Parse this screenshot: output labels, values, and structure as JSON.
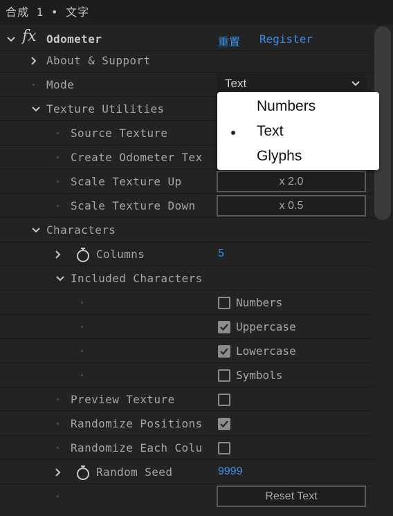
{
  "window": {
    "title": "合成 1 • 文字"
  },
  "effect": {
    "icon": "fx-icon",
    "name": "Odometer",
    "reset_label": "重置",
    "register_label": "Register"
  },
  "rows": {
    "about": "About & Support",
    "mode": "Mode",
    "mode_value": "Text",
    "texture_utilities": "Texture Utilities",
    "source_texture": "Source Texture",
    "create_odometer": "Create Odometer Tex",
    "scale_up": "Scale Texture Up",
    "scale_up_btn": "x 2.0",
    "scale_down": "Scale Texture Down",
    "scale_down_btn": "x 0.5",
    "characters": "Characters",
    "columns": "Columns",
    "columns_value": "5",
    "included_characters": "Included Characters",
    "numbers": "Numbers",
    "uppercase": "Uppercase",
    "lowercase": "Lowercase",
    "symbols": "Symbols",
    "preview_texture": "Preview Texture",
    "randomize_positions": "Randomize Positions",
    "randomize_each": "Randomize Each Colu",
    "random_seed": "Random Seed",
    "random_seed_value": "9999",
    "reset_text_btn": "Reset Text"
  },
  "checkboxes": {
    "numbers": false,
    "uppercase": true,
    "lowercase": true,
    "symbols": false,
    "preview_texture": false,
    "randomize_positions": true,
    "randomize_each": false
  },
  "dropdown": {
    "options": [
      "Numbers",
      "Text",
      "Glyphs"
    ],
    "selected": "Text"
  },
  "colors": {
    "link_blue": "#3a8ee6",
    "panel_bg": "#232323"
  }
}
